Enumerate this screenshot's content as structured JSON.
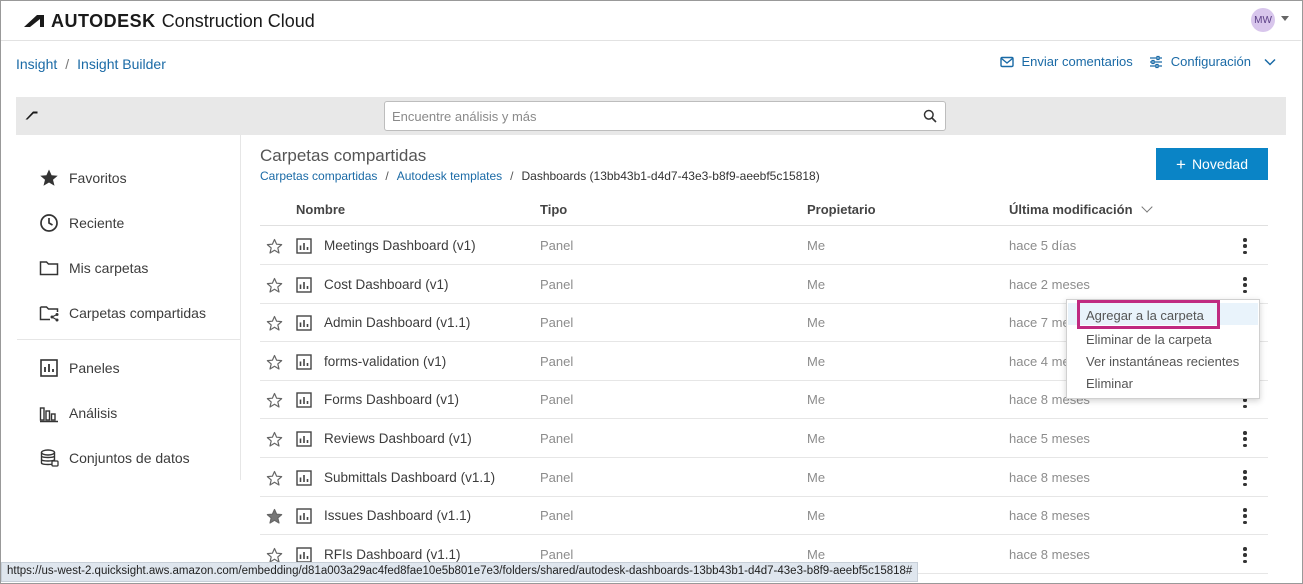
{
  "app": {
    "brand_bold": "AUTODESK",
    "brand_light": "Construction Cloud",
    "avatar_initials": "MW"
  },
  "breadcrumb": {
    "items": [
      "Insight",
      "Insight Builder"
    ],
    "separator": "/"
  },
  "actions": {
    "feedback_label": "Enviar comentarios",
    "settings_label": "Configuración"
  },
  "search": {
    "placeholder": "Encuentre análisis y más"
  },
  "sidebar": {
    "items": [
      {
        "label": "Favoritos",
        "icon": "star-icon"
      },
      {
        "label": "Reciente",
        "icon": "clock-icon"
      },
      {
        "label": "Mis carpetas",
        "icon": "folder-icon"
      },
      {
        "label": "Carpetas compartidas",
        "icon": "shared-folder-icon"
      },
      {
        "label": "Paneles",
        "icon": "dashboard-icon"
      },
      {
        "label": "Análisis",
        "icon": "analysis-icon"
      },
      {
        "label": "Conjuntos de datos",
        "icon": "dataset-icon"
      }
    ]
  },
  "main": {
    "title": "Carpetas compartidas",
    "path": [
      "Carpetas compartidas",
      "Autodesk templates",
      "Dashboards (13bb43b1-d4d7-43e3-b8f9-aeebf5c15818)"
    ],
    "new_button": "Novedad",
    "columns": [
      "Nombre",
      "Tipo",
      "Propietario",
      "Última modificación"
    ],
    "rows": [
      {
        "name": "Meetings Dashboard (v1)",
        "type": "Panel",
        "owner": "Me",
        "modified": "hace 5 días",
        "favorite": false
      },
      {
        "name": "Cost Dashboard (v1)",
        "type": "Panel",
        "owner": "Me",
        "modified": "hace 2 meses",
        "favorite": false
      },
      {
        "name": "Admin Dashboard (v1.1)",
        "type": "Panel",
        "owner": "Me",
        "modified": "hace 7 meses",
        "favorite": false
      },
      {
        "name": "forms-validation (v1)",
        "type": "Panel",
        "owner": "Me",
        "modified": "hace 4 meses",
        "favorite": false
      },
      {
        "name": "Forms Dashboard (v1)",
        "type": "Panel",
        "owner": "Me",
        "modified": "hace 8 meses",
        "favorite": false
      },
      {
        "name": "Reviews Dashboard (v1)",
        "type": "Panel",
        "owner": "Me",
        "modified": "hace 5 meses",
        "favorite": false
      },
      {
        "name": "Submittals Dashboard (v1.1)",
        "type": "Panel",
        "owner": "Me",
        "modified": "hace 8 meses",
        "favorite": false
      },
      {
        "name": "Issues Dashboard (v1.1)",
        "type": "Panel",
        "owner": "Me",
        "modified": "hace 8 meses",
        "favorite": true
      },
      {
        "name": "RFIs Dashboard (v1.1)",
        "type": "Panel",
        "owner": "Me",
        "modified": "hace 8 meses",
        "favorite": false
      }
    ]
  },
  "context_menu": {
    "items": [
      "Agregar a la carpeta",
      "Eliminar de la carpeta",
      "Ver instantáneas recientes",
      "Eliminar"
    ],
    "highlighted_index": 0
  },
  "status_bar": {
    "url": "https://us-west-2.quicksight.aws.amazon.com/embedding/d81a003a29ac4fed8fae10e5b801e7e3/folders/shared/autodesk-dashboards-13bb43b1-d4d7-43e3-b8f9-aeebf5c15818#"
  },
  "colors": {
    "accent": "#0a84c6",
    "link": "#1a6aa6",
    "focus_outline": "#c02a80"
  }
}
